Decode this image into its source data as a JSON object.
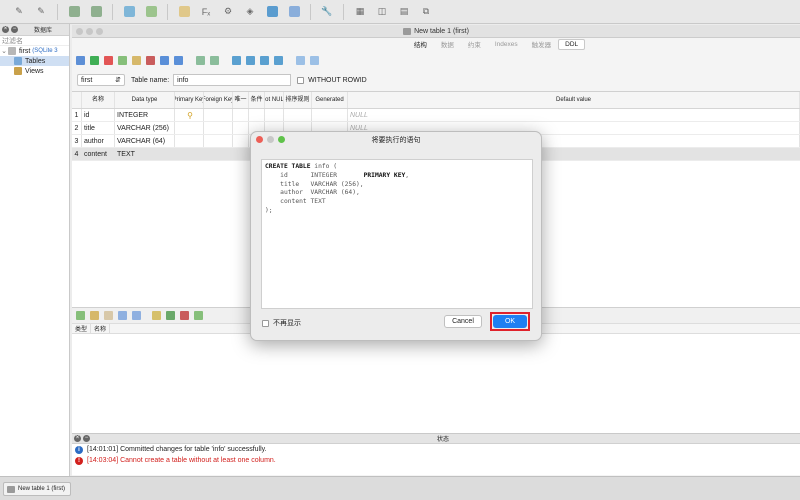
{
  "sidebar": {
    "header_title": "数据库",
    "filter_placeholder": "过滤名",
    "tree": [
      {
        "label": "first",
        "note": "(SQLite 3",
        "type": "database"
      },
      {
        "label": "Tables",
        "type": "folder",
        "selected": true
      },
      {
        "label": "Views",
        "type": "folder"
      }
    ]
  },
  "window": {
    "title": "New table 1 (first)",
    "tabs": [
      "结构",
      "数据",
      "约束",
      "Indexes",
      "触发器",
      "DDL"
    ],
    "active_tab": "DDL"
  },
  "table_bar": {
    "schema_value": "first",
    "table_name_label": "Table name:",
    "table_name_value": "info",
    "without_rowid_label": "WITHOUT ROWID"
  },
  "grid": {
    "headers": [
      "",
      "名称",
      "Data type",
      "Primary Key",
      "Foreign Key",
      "唯一",
      "条件",
      "Not NULL",
      "排序规则",
      "Generated",
      "Default value"
    ],
    "rows": [
      {
        "num": "1",
        "name": "id",
        "type": "INTEGER",
        "pk": true,
        "default": "NULL"
      },
      {
        "num": "2",
        "name": "title",
        "type": "VARCHAR (256)",
        "pk": false,
        "default": "NULL"
      },
      {
        "num": "3",
        "name": "author",
        "type": "VARCHAR (64)",
        "pk": false,
        "default": ""
      },
      {
        "num": "4",
        "name": "content",
        "type": "TEXT",
        "pk": false,
        "default": ""
      }
    ]
  },
  "lower_panel": {
    "headers": [
      "类型",
      "名称"
    ]
  },
  "status": {
    "title": "状态",
    "messages": [
      {
        "time": "[14:01:01]",
        "text": "Committed changes for table 'info' successfully.",
        "level": "info"
      },
      {
        "time": "[14:03:04]",
        "text": "Cannot create a table without at least one column.",
        "level": "error"
      }
    ]
  },
  "bottom_tab": {
    "label": "New table 1 (first)"
  },
  "dialog": {
    "title": "将要执行的语句",
    "sql_lines": [
      {
        "kw": "CREATE TABLE",
        "rest": " info ("
      },
      {
        "rest": "    id      INTEGER       ",
        "kw2": "PRIMARY KEY",
        "rest2": ","
      },
      {
        "rest": "    title   VARCHAR (256),"
      },
      {
        "rest": "    author  VARCHAR (64),"
      },
      {
        "rest": "    content TEXT"
      },
      {
        "rest": ");"
      }
    ],
    "dont_show_label": "不再显示",
    "cancel_label": "Cancel",
    "ok_label": "OK"
  },
  "colors": {
    "accent_blue": "#1f7ff2",
    "highlight_red": "#e0222b",
    "error_red": "#d2201d",
    "info_blue": "#2c6cc4"
  }
}
